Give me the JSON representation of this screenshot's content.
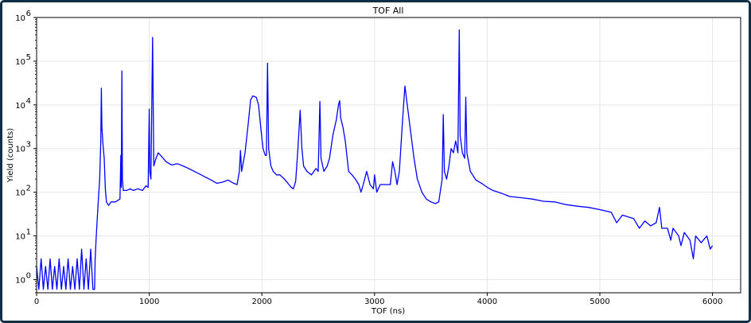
{
  "chart_data": {
    "type": "line",
    "title": "TOF All",
    "xlabel": "TOF (ns)",
    "ylabel": "Yield (counts)",
    "xlim": [
      0,
      6250
    ],
    "ylim": [
      0.5,
      1000000
    ],
    "yscale": "log",
    "grid": true,
    "x_ticks": [
      0,
      1000,
      2000,
      3000,
      4000,
      5000,
      6000
    ],
    "x_tick_labels": [
      "0",
      "1000",
      "2000",
      "3000",
      "4000",
      "5000",
      "6000"
    ],
    "y_ticks": [
      1,
      10,
      100,
      1000,
      10000,
      100000,
      1000000
    ],
    "y_tick_labels": [
      {
        "base": "10",
        "exp": "0"
      },
      {
        "base": "10",
        "exp": "1"
      },
      {
        "base": "10",
        "exp": "2"
      },
      {
        "base": "10",
        "exp": "3"
      },
      {
        "base": "10",
        "exp": "4"
      },
      {
        "base": "10",
        "exp": "5"
      },
      {
        "base": "10",
        "exp": "6"
      }
    ],
    "series": [
      {
        "color": "#0000ff",
        "points": [
          [
            0,
            2
          ],
          [
            20,
            0.6
          ],
          [
            40,
            3
          ],
          [
            60,
            0.6
          ],
          [
            80,
            2
          ],
          [
            100,
            0.6
          ],
          [
            120,
            3
          ],
          [
            140,
            0.6
          ],
          [
            160,
            2
          ],
          [
            180,
            0.6
          ],
          [
            200,
            3
          ],
          [
            220,
            0.6
          ],
          [
            240,
            2
          ],
          [
            260,
            0.6
          ],
          [
            280,
            3
          ],
          [
            300,
            0.6
          ],
          [
            320,
            2
          ],
          [
            340,
            0.6
          ],
          [
            360,
            3
          ],
          [
            380,
            0.6
          ],
          [
            400,
            5
          ],
          [
            420,
            0.6
          ],
          [
            440,
            3
          ],
          [
            460,
            0.6
          ],
          [
            480,
            5
          ],
          [
            500,
            0.6
          ],
          [
            515,
            0.6
          ],
          [
            520,
            3
          ],
          [
            530,
            10
          ],
          [
            540,
            30
          ],
          [
            550,
            80
          ],
          [
            560,
            200
          ],
          [
            570,
            1500
          ],
          [
            575,
            24000
          ],
          [
            580,
            3000
          ],
          [
            590,
            1200
          ],
          [
            600,
            600
          ],
          [
            610,
            120
          ],
          [
            620,
            60
          ],
          [
            640,
            50
          ],
          [
            660,
            60
          ],
          [
            680,
            60
          ],
          [
            700,
            60
          ],
          [
            720,
            65
          ],
          [
            740,
            70
          ],
          [
            748,
            700
          ],
          [
            752,
            130
          ],
          [
            757,
            60000
          ],
          [
            762,
            200
          ],
          [
            770,
            110
          ],
          [
            800,
            110
          ],
          [
            830,
            120
          ],
          [
            860,
            110
          ],
          [
            900,
            120
          ],
          [
            940,
            110
          ],
          [
            970,
            140
          ],
          [
            990,
            130
          ],
          [
            1000,
            8000
          ],
          [
            1005,
            300
          ],
          [
            1015,
            200
          ],
          [
            1030,
            350000
          ],
          [
            1040,
            400
          ],
          [
            1060,
            600
          ],
          [
            1080,
            800
          ],
          [
            1100,
            700
          ],
          [
            1150,
            500
          ],
          [
            1200,
            420
          ],
          [
            1250,
            450
          ],
          [
            1300,
            400
          ],
          [
            1350,
            350
          ],
          [
            1400,
            300
          ],
          [
            1450,
            260
          ],
          [
            1500,
            220
          ],
          [
            1550,
            190
          ],
          [
            1600,
            160
          ],
          [
            1650,
            170
          ],
          [
            1700,
            190
          ],
          [
            1750,
            160
          ],
          [
            1780,
            150
          ],
          [
            1800,
            300
          ],
          [
            1810,
            900
          ],
          [
            1820,
            300
          ],
          [
            1850,
            800
          ],
          [
            1880,
            4000
          ],
          [
            1900,
            13000
          ],
          [
            1920,
            16000
          ],
          [
            1950,
            15000
          ],
          [
            1970,
            10000
          ],
          [
            1990,
            3000
          ],
          [
            2010,
            1000
          ],
          [
            2030,
            700
          ],
          [
            2040,
            700
          ],
          [
            2050,
            90000
          ],
          [
            2060,
            1000
          ],
          [
            2080,
            400
          ],
          [
            2100,
            300
          ],
          [
            2130,
            250
          ],
          [
            2160,
            250
          ],
          [
            2200,
            200
          ],
          [
            2240,
            150
          ],
          [
            2260,
            130
          ],
          [
            2280,
            120
          ],
          [
            2300,
            180
          ],
          [
            2320,
            1000
          ],
          [
            2340,
            7500
          ],
          [
            2355,
            1000
          ],
          [
            2370,
            400
          ],
          [
            2400,
            300
          ],
          [
            2440,
            250
          ],
          [
            2480,
            350
          ],
          [
            2500,
            300
          ],
          [
            2515,
            12000
          ],
          [
            2525,
            600
          ],
          [
            2550,
            300
          ],
          [
            2580,
            400
          ],
          [
            2600,
            600
          ],
          [
            2630,
            2000
          ],
          [
            2660,
            4500
          ],
          [
            2680,
            10000
          ],
          [
            2690,
            12500
          ],
          [
            2700,
            5000
          ],
          [
            2720,
            3000
          ],
          [
            2740,
            1500
          ],
          [
            2770,
            300
          ],
          [
            2800,
            250
          ],
          [
            2830,
            200
          ],
          [
            2860,
            150
          ],
          [
            2880,
            100
          ],
          [
            2900,
            150
          ],
          [
            2930,
            300
          ],
          [
            2960,
            150
          ],
          [
            2990,
            120
          ],
          [
            3000,
            250
          ],
          [
            3020,
            100
          ],
          [
            3050,
            150
          ],
          [
            3080,
            150
          ],
          [
            3110,
            150
          ],
          [
            3140,
            150
          ],
          [
            3160,
            500
          ],
          [
            3180,
            300
          ],
          [
            3200,
            150
          ],
          [
            3220,
            300
          ],
          [
            3240,
            2000
          ],
          [
            3260,
            12000
          ],
          [
            3270,
            27000
          ],
          [
            3290,
            10000
          ],
          [
            3320,
            2500
          ],
          [
            3350,
            600
          ],
          [
            3380,
            200
          ],
          [
            3420,
            100
          ],
          [
            3460,
            70
          ],
          [
            3500,
            60
          ],
          [
            3540,
            55
          ],
          [
            3570,
            60
          ],
          [
            3600,
            200
          ],
          [
            3610,
            6000
          ],
          [
            3620,
            300
          ],
          [
            3640,
            200
          ],
          [
            3660,
            400
          ],
          [
            3680,
            1000
          ],
          [
            3700,
            800
          ],
          [
            3720,
            1500
          ],
          [
            3740,
            800
          ],
          [
            3752,
            520000
          ],
          [
            3760,
            2000
          ],
          [
            3780,
            800
          ],
          [
            3800,
            600
          ],
          [
            3810,
            15000
          ],
          [
            3820,
            800
          ],
          [
            3850,
            300
          ],
          [
            3900,
            190
          ],
          [
            3950,
            160
          ],
          [
            4000,
            130
          ],
          [
            4050,
            110
          ],
          [
            4100,
            100
          ],
          [
            4150,
            90
          ],
          [
            4200,
            80
          ],
          [
            4300,
            75
          ],
          [
            4400,
            70
          ],
          [
            4500,
            62
          ],
          [
            4600,
            60
          ],
          [
            4700,
            52
          ],
          [
            4800,
            48
          ],
          [
            4900,
            45
          ],
          [
            5000,
            40
          ],
          [
            5100,
            35
          ],
          [
            5150,
            20
          ],
          [
            5200,
            30
          ],
          [
            5300,
            25
          ],
          [
            5350,
            15
          ],
          [
            5400,
            22
          ],
          [
            5450,
            17
          ],
          [
            5500,
            20
          ],
          [
            5530,
            45
          ],
          [
            5550,
            15
          ],
          [
            5600,
            15
          ],
          [
            5630,
            8
          ],
          [
            5650,
            15
          ],
          [
            5700,
            10
          ],
          [
            5720,
            6
          ],
          [
            5750,
            12
          ],
          [
            5800,
            8
          ],
          [
            5830,
            3
          ],
          [
            5850,
            10
          ],
          [
            5900,
            7
          ],
          [
            5950,
            10
          ],
          [
            5980,
            5
          ],
          [
            6000,
            6
          ]
        ]
      }
    ]
  }
}
